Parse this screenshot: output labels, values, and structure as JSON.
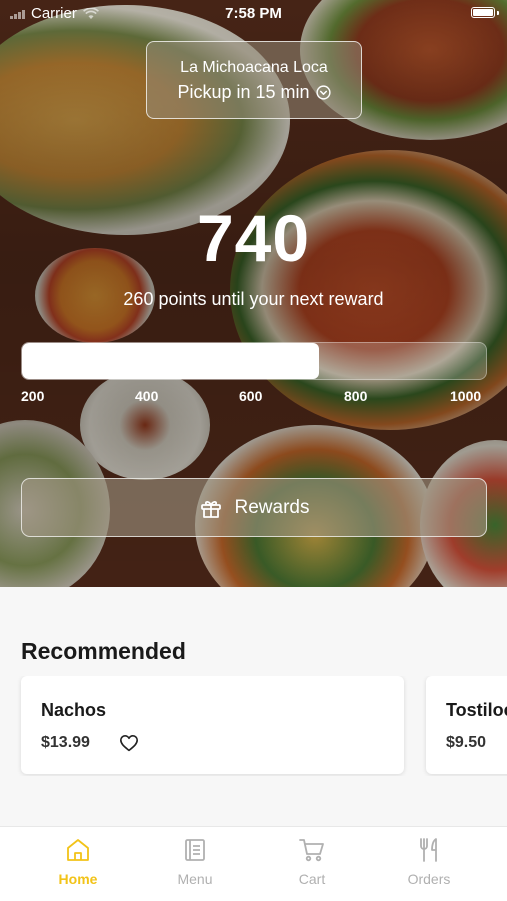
{
  "status_bar": {
    "carrier": "Carrier",
    "time": "7:58 PM"
  },
  "location": {
    "name": "La Michoacana Loca",
    "pickup": "Pickup in 15 min",
    "icon": "chevron-circle-down-icon"
  },
  "rewards": {
    "points": "740",
    "caption": "260 points until your next reward",
    "progress_fraction": 0.64,
    "ticks": [
      "200",
      "400",
      "600",
      "800",
      "1000"
    ],
    "button_label": "Rewards",
    "button_icon": "gift-icon"
  },
  "recommended": {
    "title": "Recommended",
    "items": [
      {
        "name": "Nachos",
        "price": "$13.99"
      },
      {
        "name": "Tostilocos",
        "price": "$9.50"
      }
    ]
  },
  "tabs": [
    {
      "label": "Home",
      "icon": "home-icon",
      "active": true
    },
    {
      "label": "Menu",
      "icon": "menu-icon",
      "active": false
    },
    {
      "label": "Cart",
      "icon": "cart-icon",
      "active": false
    },
    {
      "label": "Orders",
      "icon": "fork-knife-icon",
      "active": false
    }
  ],
  "colors": {
    "accent": "#f2c318",
    "inactive_tab": "#b0b0b0"
  }
}
